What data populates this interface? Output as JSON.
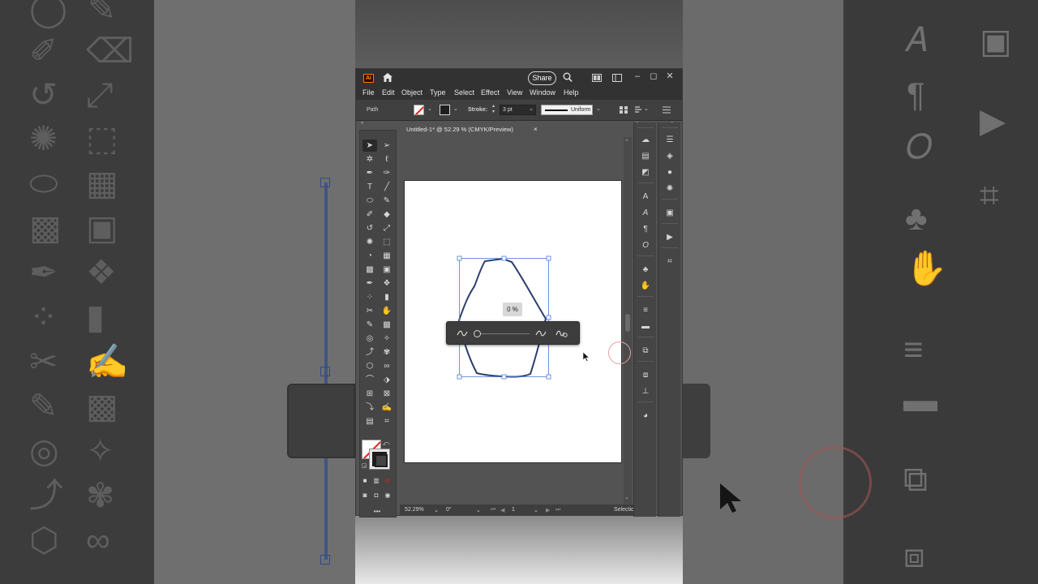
{
  "app": {
    "logo": "Ai",
    "share_label": "Share",
    "window_controls": [
      "–",
      "◻",
      "✕"
    ]
  },
  "menu": [
    "File",
    "Edit",
    "Object",
    "Type",
    "Select",
    "Effect",
    "View",
    "Window",
    "Help"
  ],
  "control_bar": {
    "selection_label": "Path",
    "stroke_label": "Stroke:",
    "stroke_weight": "3 pt",
    "profile": "Uniform"
  },
  "document": {
    "tab_title": "Untitled-1* @ 52.29 % (CMYK/Preview)",
    "close": "×"
  },
  "simplify": {
    "percent": "0 %"
  },
  "status": {
    "zoom": "52.29%",
    "rotation": "0°",
    "artboard": "1",
    "tool": "Selectio"
  },
  "colors": {
    "path_stroke": "#2e3f6e",
    "selection": "#4a7bd6",
    "ui_dark": "#323232",
    "panel": "#535353"
  },
  "icons": {
    "home": "home-icon",
    "search": "search-icon",
    "arrange": "arrange-documents-icon",
    "workspace": "workspace-switcher-icon"
  }
}
